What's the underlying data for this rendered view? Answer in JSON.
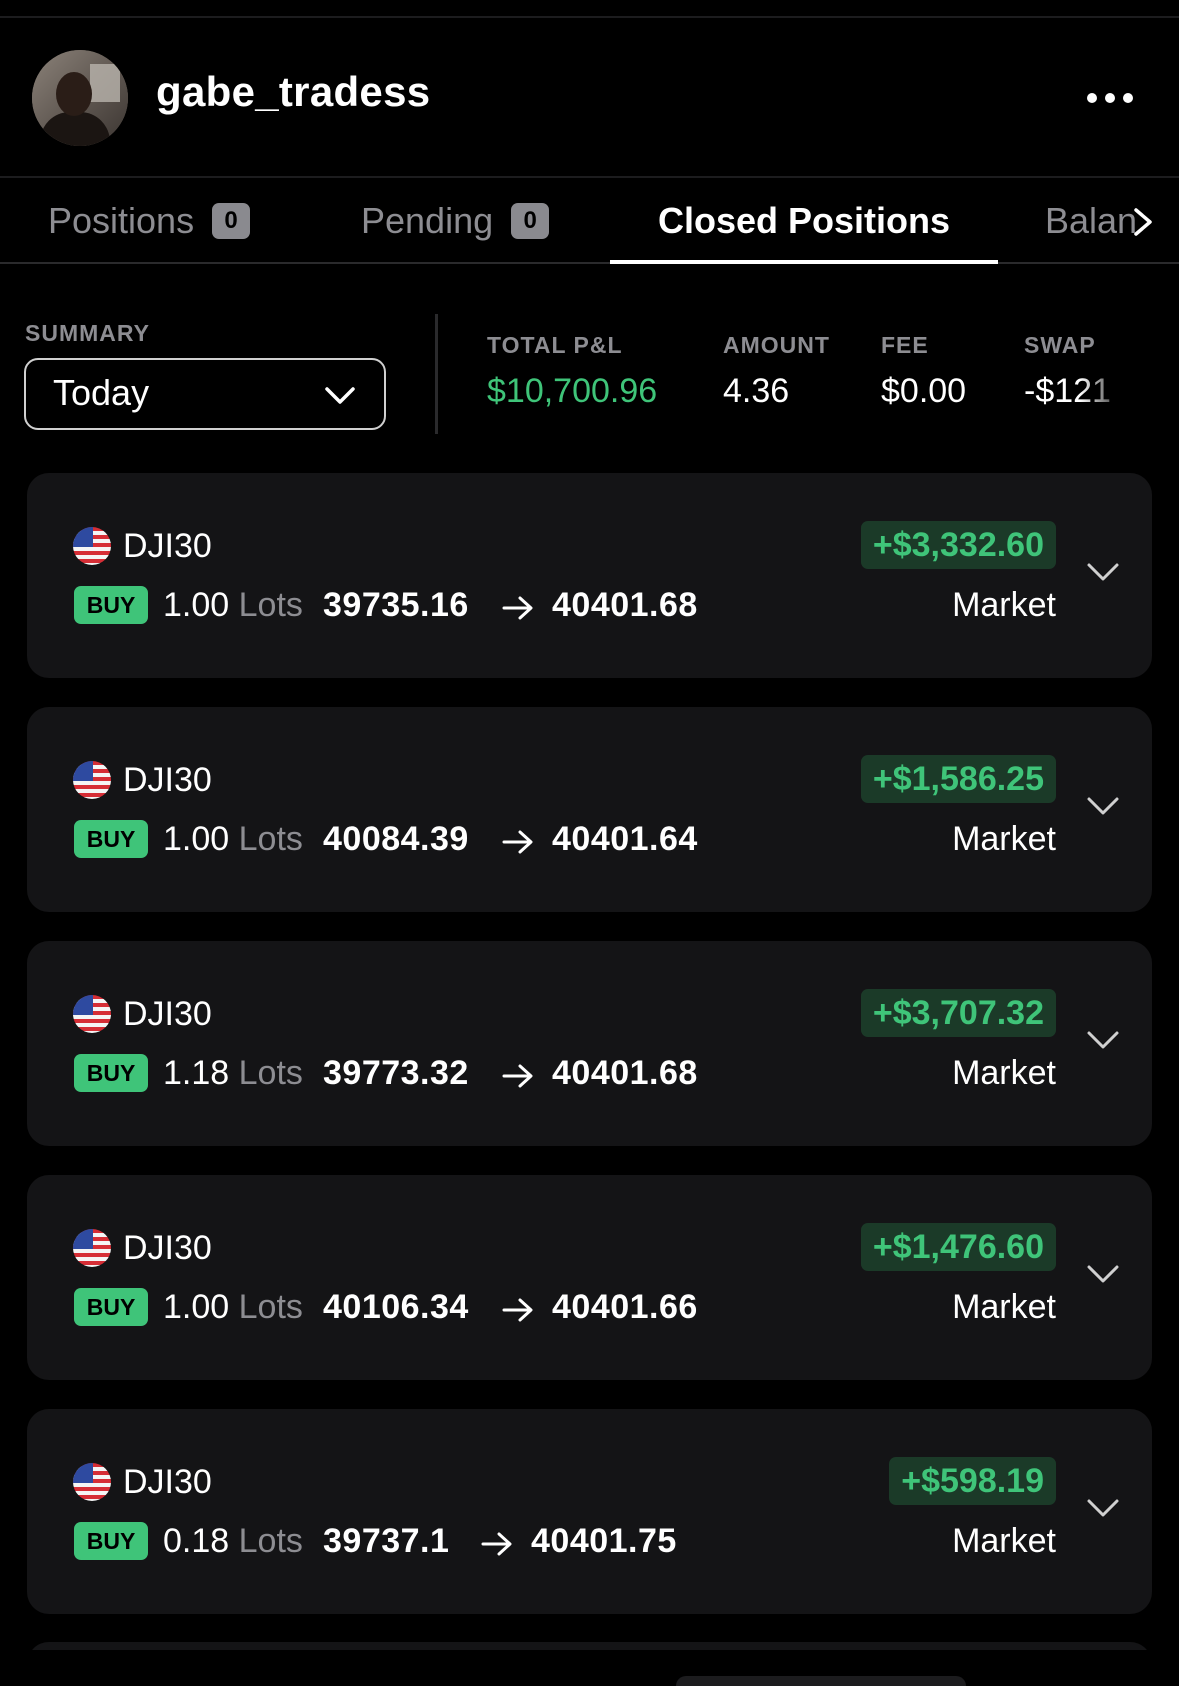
{
  "header": {
    "username": "gabe_tradess"
  },
  "tabs": [
    {
      "label": "Positions",
      "badge": "0"
    },
    {
      "label": "Pending",
      "badge": "0"
    },
    {
      "label": "Closed Positions"
    },
    {
      "label": "Balan"
    }
  ],
  "summary": {
    "label": "SUMMARY",
    "range": "Today",
    "stats": [
      {
        "label": "TOTAL P&L",
        "value": "$10,700.96"
      },
      {
        "label": "AMOUNT",
        "value": "4.36"
      },
      {
        "label": "FEE",
        "value": "$0.00"
      },
      {
        "label": "SWAP",
        "value": "-$121"
      }
    ]
  },
  "positions": [
    {
      "symbol": "DJI30",
      "side": "BUY",
      "lots": "1.00",
      "lots_unit": "Lots",
      "open": "39735.16",
      "close": "40401.68",
      "pnl": "+$3,332.60",
      "order_type": "Market"
    },
    {
      "symbol": "DJI30",
      "side": "BUY",
      "lots": "1.00",
      "lots_unit": "Lots",
      "open": "40084.39",
      "close": "40401.64",
      "pnl": "+$1,586.25",
      "order_type": "Market"
    },
    {
      "symbol": "DJI30",
      "side": "BUY",
      "lots": "1.18",
      "lots_unit": "Lots",
      "open": "39773.32",
      "close": "40401.68",
      "pnl": "+$3,707.32",
      "order_type": "Market"
    },
    {
      "symbol": "DJI30",
      "side": "BUY",
      "lots": "1.00",
      "lots_unit": "Lots",
      "open": "40106.34",
      "close": "40401.66",
      "pnl": "+$1,476.60",
      "order_type": "Market"
    },
    {
      "symbol": "DJI30",
      "side": "BUY",
      "lots": "0.18",
      "lots_unit": "Lots",
      "open": "39737.1",
      "close": "40401.75",
      "pnl": "+$598.19",
      "order_type": "Market"
    }
  ],
  "colors": {
    "background": "#000000",
    "card": "#141416",
    "profit": "#3fc479",
    "profit_bg": "#1b3a28",
    "muted": "#8d8d92"
  }
}
